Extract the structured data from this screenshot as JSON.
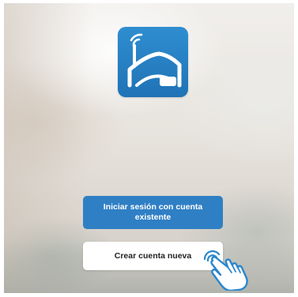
{
  "logo": {
    "icon": "house-wifi-icon",
    "colors": {
      "background": "#2b87cb",
      "foreground": "#ffffff"
    }
  },
  "buttons": {
    "login_label": "Iniciar sesión con cuenta existente",
    "create_label": "Crear cuenta nueva"
  },
  "pointer": {
    "icon": "tap-hand-icon",
    "color": "#2a86cc"
  },
  "colors": {
    "primary": "#2f7fc4",
    "secondary_bg": "#ffffff",
    "secondary_text": "#222222"
  }
}
